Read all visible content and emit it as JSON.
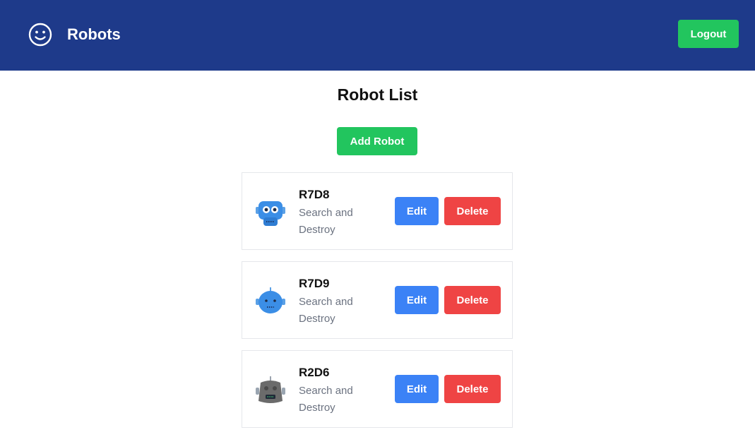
{
  "header": {
    "brand_icon": "smiley-icon",
    "title": "Robots",
    "logout_label": "Logout"
  },
  "main": {
    "title": "Robot List",
    "add_label": "Add Robot",
    "robots": [
      {
        "name": "R7D8",
        "description": "Search and Destroy",
        "avatar_icon": "robot-blue-goggles-icon",
        "edit_label": "Edit",
        "delete_label": "Delete"
      },
      {
        "name": "R7D9",
        "description": "Search and Destroy",
        "avatar_icon": "robot-blue-round-icon",
        "edit_label": "Edit",
        "delete_label": "Delete"
      },
      {
        "name": "R2D6",
        "description": "Search and Destroy",
        "avatar_icon": "robot-gray-icon",
        "edit_label": "Edit",
        "delete_label": "Delete"
      }
    ]
  },
  "colors": {
    "header_bg": "#1e3a8a",
    "green": "#22c55e",
    "blue": "#3b82f6",
    "red": "#ef4444",
    "muted_text": "#6b7280"
  }
}
